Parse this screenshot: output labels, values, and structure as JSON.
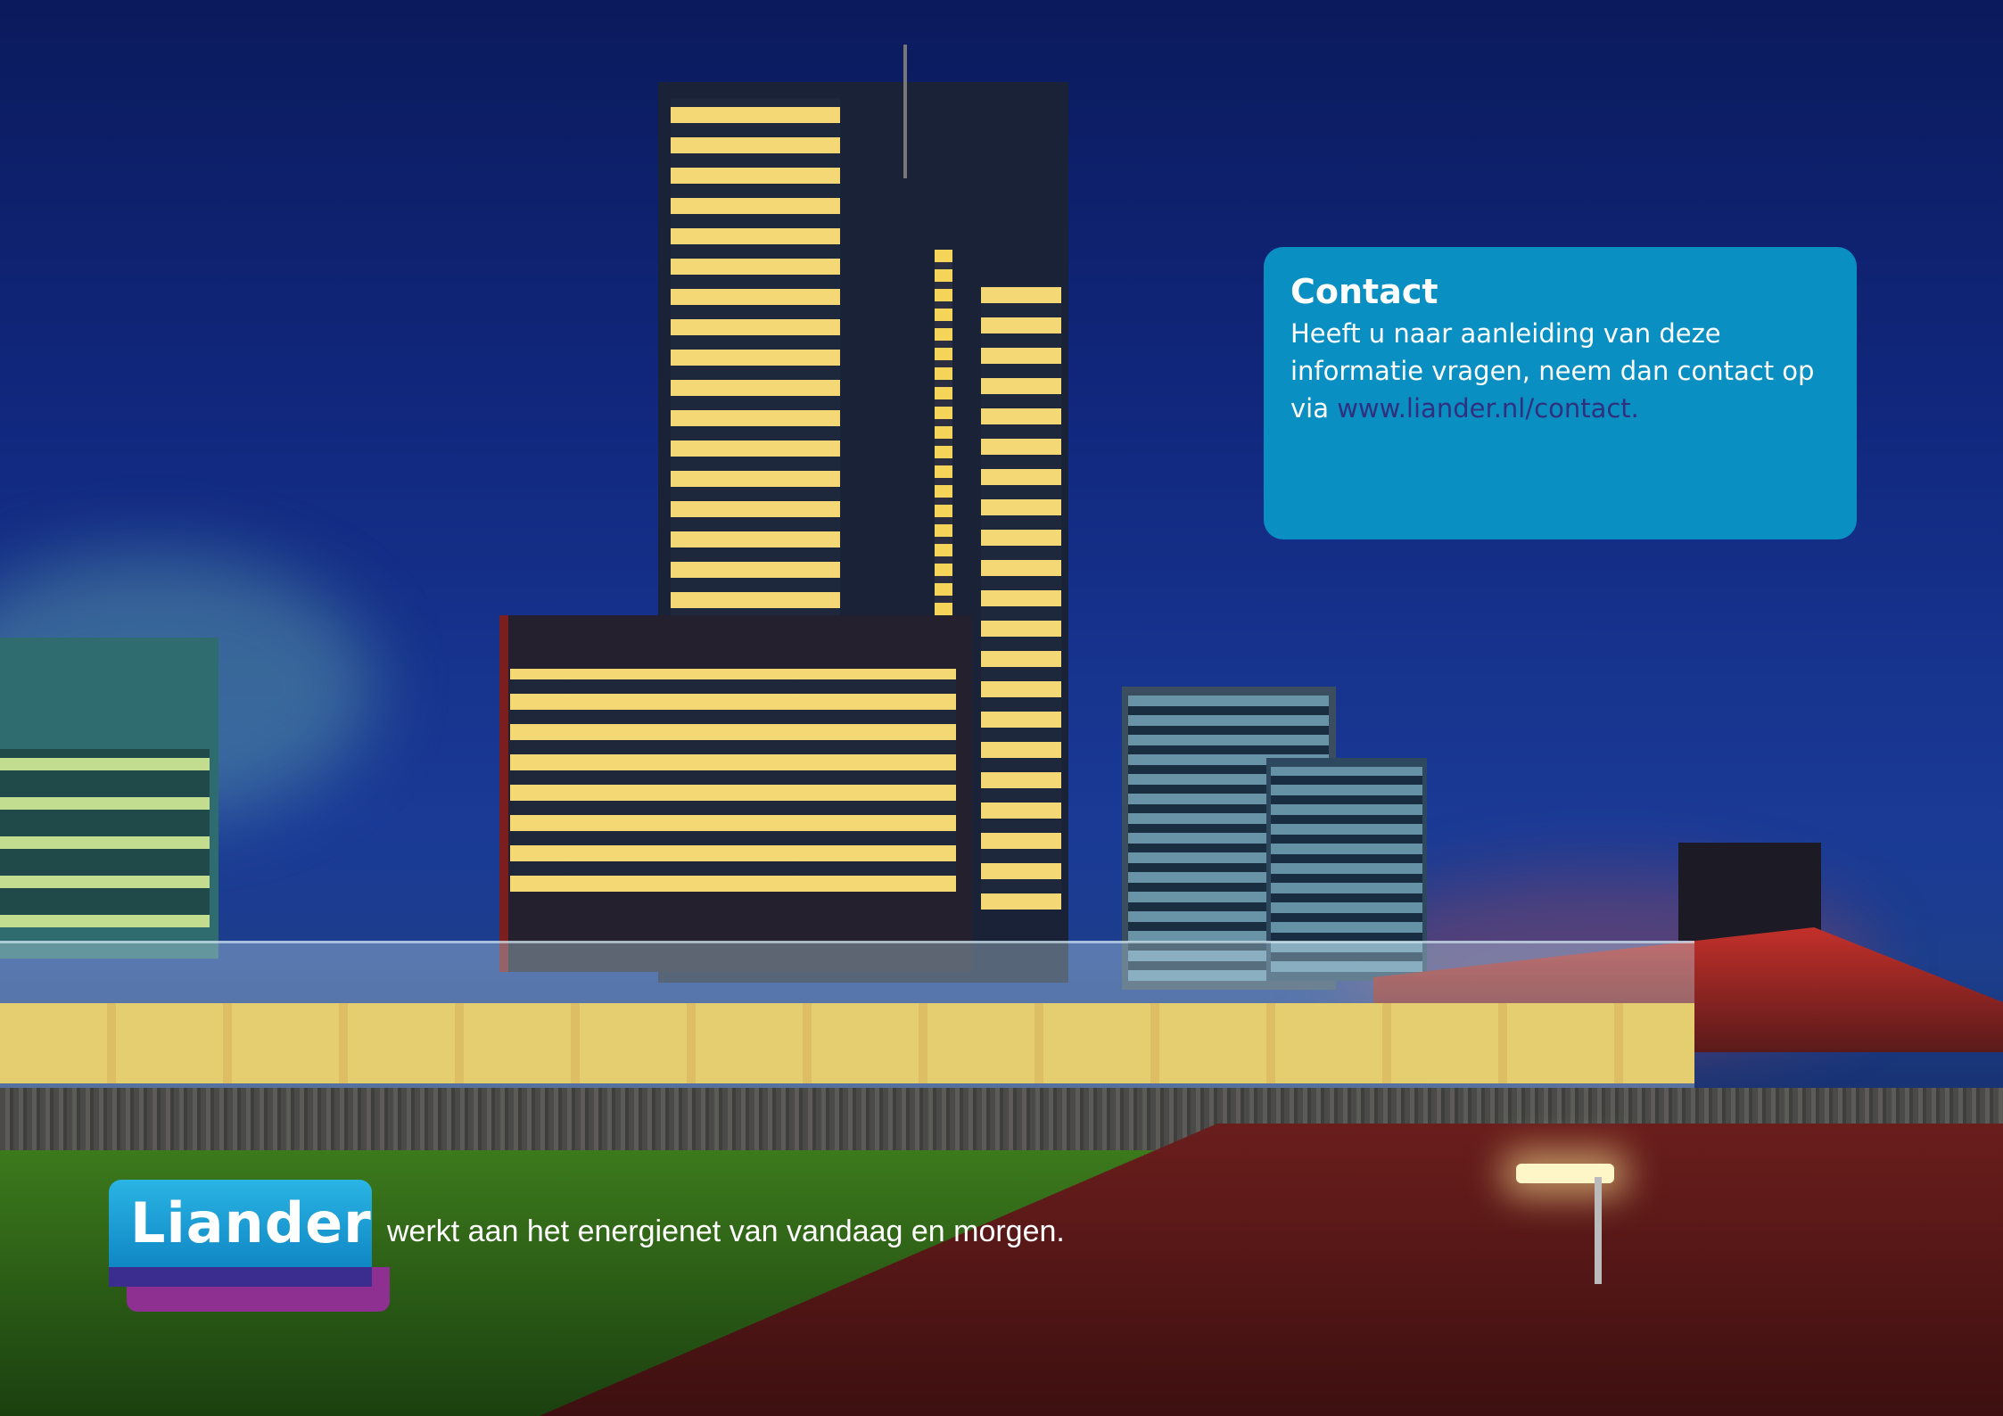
{
  "contact": {
    "title": "Contact",
    "body": "Heeft u naar aanleiding van deze informatie vragen, neem dan contact op via ",
    "link": "www.liander.nl/contact."
  },
  "brand": {
    "logo_text": "Liander",
    "tagline": "werkt aan het energienet van vandaag en morgen."
  },
  "colors": {
    "contact_box": "#0a8fc2",
    "link": "#31307e",
    "logo_blue": "#1a9ad6",
    "logo_purple": "#8e2f92"
  }
}
